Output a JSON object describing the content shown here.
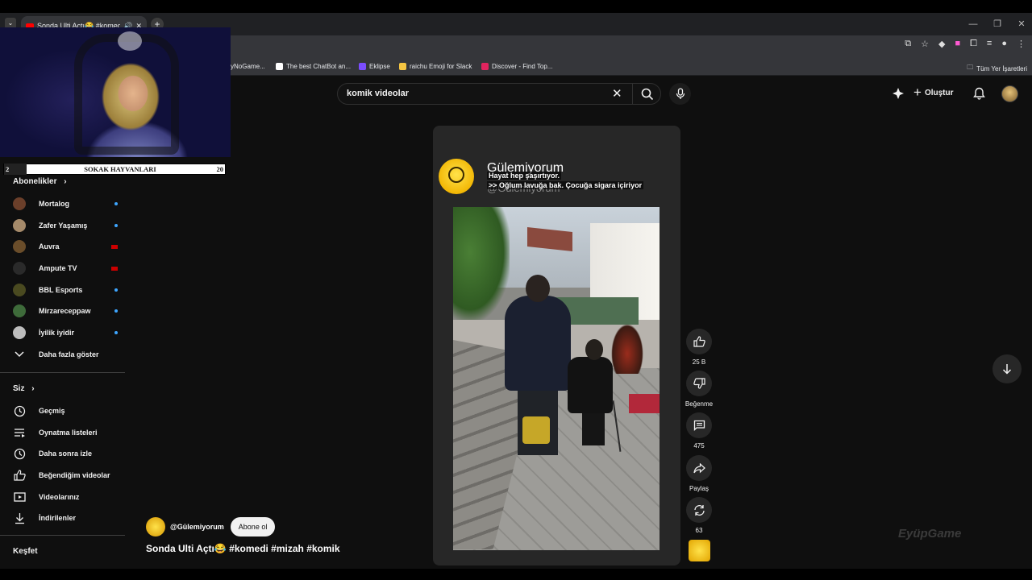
{
  "browser": {
    "tab_title": "Sonda Ulti Açtı😂 #komedi",
    "bookmarks": [
      {
        "label": "yNoGame...",
        "color": "#3a3a3a"
      },
      {
        "label": "The best ChatBot an...",
        "color": "#ffffff"
      },
      {
        "label": "Eklipse",
        "color": "#7b4dff"
      },
      {
        "label": "raichu Emoji for Slack",
        "color": "#f5c542"
      },
      {
        "label": "Discover - Find Top...",
        "color": "#e0245e"
      }
    ],
    "all_bookmarks": "Tüm Yer İşaretleri"
  },
  "search": {
    "value": "komik videolar"
  },
  "header": {
    "create_label": "Oluştur"
  },
  "stream_overlay": {
    "left_number": "2",
    "title": "SOKAK HAYVANLARI",
    "right_number": "20"
  },
  "sidebar": {
    "subscriptions_title": "Abonelikler",
    "subscriptions": [
      {
        "name": "Mortalog",
        "avatar": "#6b3f2a",
        "status": "dot"
      },
      {
        "name": "Zafer Yaşamış",
        "avatar": "#a58a6a",
        "status": "dot"
      },
      {
        "name": "Auvra",
        "avatar": "#6a4d2a",
        "status": "flag"
      },
      {
        "name": "Ampute TV",
        "avatar": "#2a2a2a",
        "status": "flag"
      },
      {
        "name": "BBL Esports",
        "avatar": "#4a4a20",
        "status": "dot"
      },
      {
        "name": "Mirzareceppaw",
        "avatar": "#3e6b3a",
        "status": "dot"
      },
      {
        "name": "İyilik iyidir",
        "avatar": "#bdbdbd",
        "status": "dot"
      }
    ],
    "show_more": "Daha fazla göster",
    "you_title": "Siz",
    "you_items": [
      {
        "label": "Geçmiş",
        "icon": "history-icon"
      },
      {
        "label": "Oynatma listeleri",
        "icon": "playlists-icon"
      },
      {
        "label": "Daha sonra izle",
        "icon": "watch-later-icon"
      },
      {
        "label": "Beğendiğim videolar",
        "icon": "liked-icon"
      },
      {
        "label": "Videolarınız",
        "icon": "your-videos-icon"
      },
      {
        "label": "İndirilenler",
        "icon": "downloads-icon"
      }
    ],
    "explore_title": "Keşfet"
  },
  "short": {
    "channel_name": "Gülemiyorum",
    "channel_handle": "@Gülemiyorum",
    "caption_line1": "Hayat hep şaşırtıyor.",
    "caption_line2": ">> Oğlum lavuğa bak. Çocuğa sigara içiriyor",
    "likes": "25 B",
    "dislike_label": "Beğenme",
    "comments": "475",
    "share_label": "Paylaş",
    "remix_count": "63",
    "subscribe_label": "Abone ol",
    "title": "Sonda Ulti Açtı😂 #komedi #mizah #komik"
  },
  "watermark": "EyüpGame"
}
